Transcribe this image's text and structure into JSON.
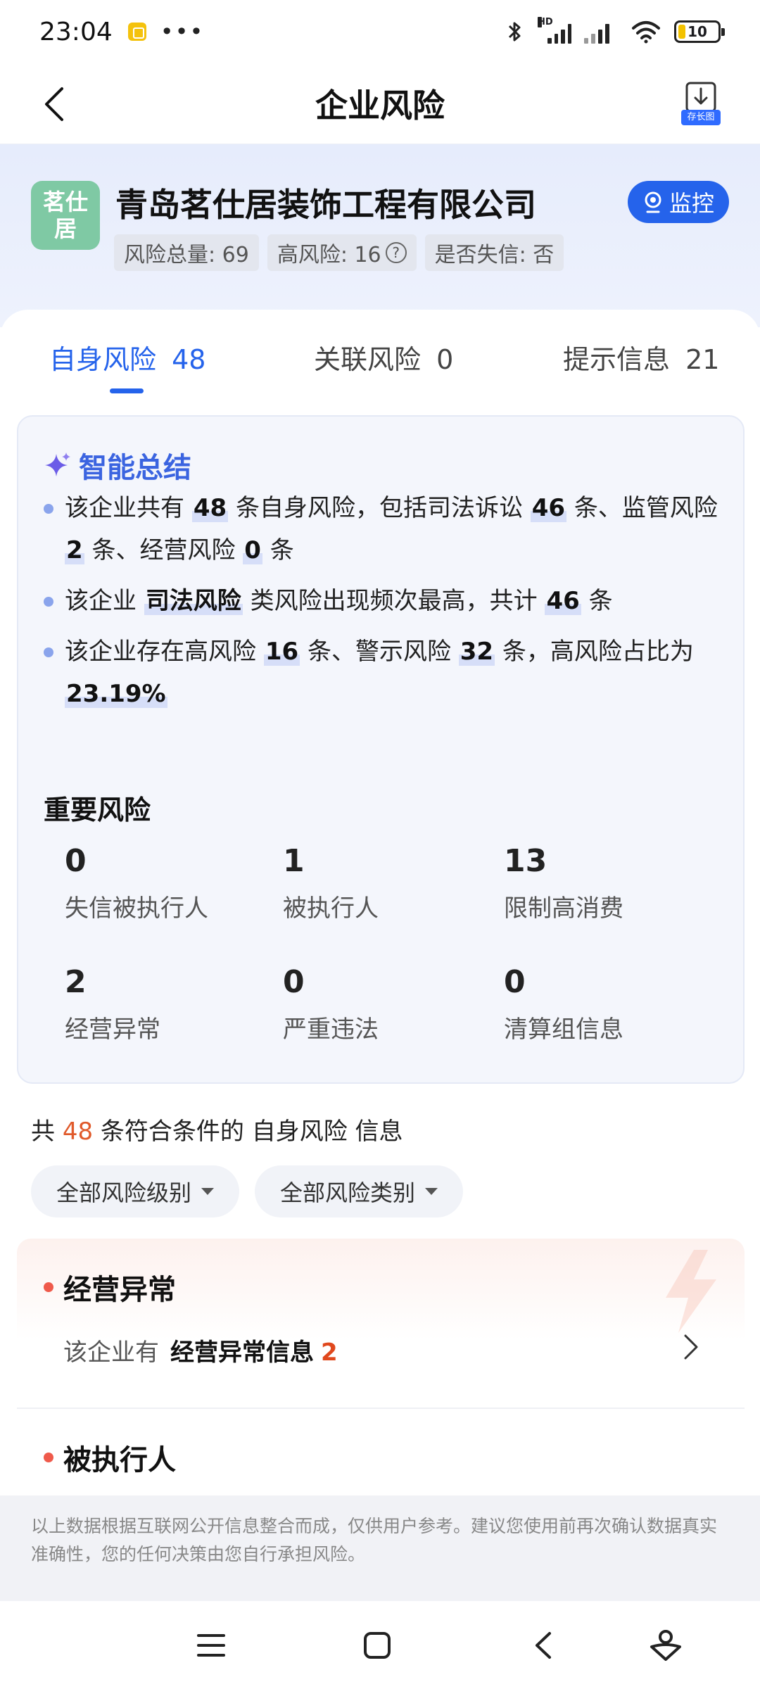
{
  "status_bar": {
    "time": "23:04",
    "more": "•••",
    "network_label": "HD",
    "battery": "10"
  },
  "title_bar": {
    "title": "企业风险",
    "save_long_image_label": "存长图"
  },
  "company": {
    "logo_line1": "茗仕",
    "logo_line2": "居",
    "name": "青岛茗仕居装饰工程有限公司",
    "monitor_label": "监控",
    "tags": {
      "total_risk": "风险总量: 69",
      "high_risk": "高风险: 16",
      "dishonest": "是否失信: 否"
    }
  },
  "tabs": [
    {
      "label": "自身风险",
      "count": "48",
      "active": true
    },
    {
      "label": "关联风险",
      "count": "0",
      "active": false
    },
    {
      "label": "提示信息",
      "count": "21",
      "active": false
    }
  ],
  "summary": {
    "title": "智能总结",
    "b1": {
      "t1": "该企业共有 ",
      "n1": "48",
      "t2": " 条自身风险，包括司法诉讼 ",
      "n2": "46",
      "t3": " 条、监管风险 ",
      "n3": "2",
      "t4": " 条、经营风险 ",
      "n4": "0",
      "t5": " 条"
    },
    "b2": {
      "t1": "该企业 ",
      "h1": "司法风险",
      "t2": " 类风险出现频次最高，共计 ",
      "n1": "46",
      "t3": " 条"
    },
    "b3": {
      "t1": "该企业存在高风险 ",
      "n1": "16",
      "t2": " 条、警示风险 ",
      "n2": "32",
      "t3": " 条，高风险占比为 ",
      "n3": "23.19%"
    }
  },
  "important_risks": {
    "title": "重要风险",
    "items": [
      {
        "value": "0",
        "label": "失信被执行人"
      },
      {
        "value": "1",
        "label": "被执行人"
      },
      {
        "value": "13",
        "label": "限制高消费"
      },
      {
        "value": "2",
        "label": "经营异常"
      },
      {
        "value": "0",
        "label": "严重违法"
      },
      {
        "value": "0",
        "label": "清算组信息"
      }
    ]
  },
  "results": {
    "prefix": "共 ",
    "count": "48",
    "middle": " 条符合条件的 ",
    "category": "自身风险",
    "suffix": " 信息"
  },
  "filters": {
    "level": "全部风险级别",
    "type": "全部风险类别"
  },
  "risk_items": [
    {
      "title": "经营异常",
      "desc": "该企业有",
      "name": "经营异常信息",
      "count": "2"
    },
    {
      "title": "被执行人"
    }
  ],
  "disclaimer": "以上数据根据互联网公开信息整合而成，仅供用户参考。建议您使用前再次确认数据真实准确性，您的任何决策由您自行承担风险。",
  "colors": {
    "accent": "#2563eb",
    "risk_red": "#e0481d",
    "logo_bg": "#7fc9a4"
  }
}
